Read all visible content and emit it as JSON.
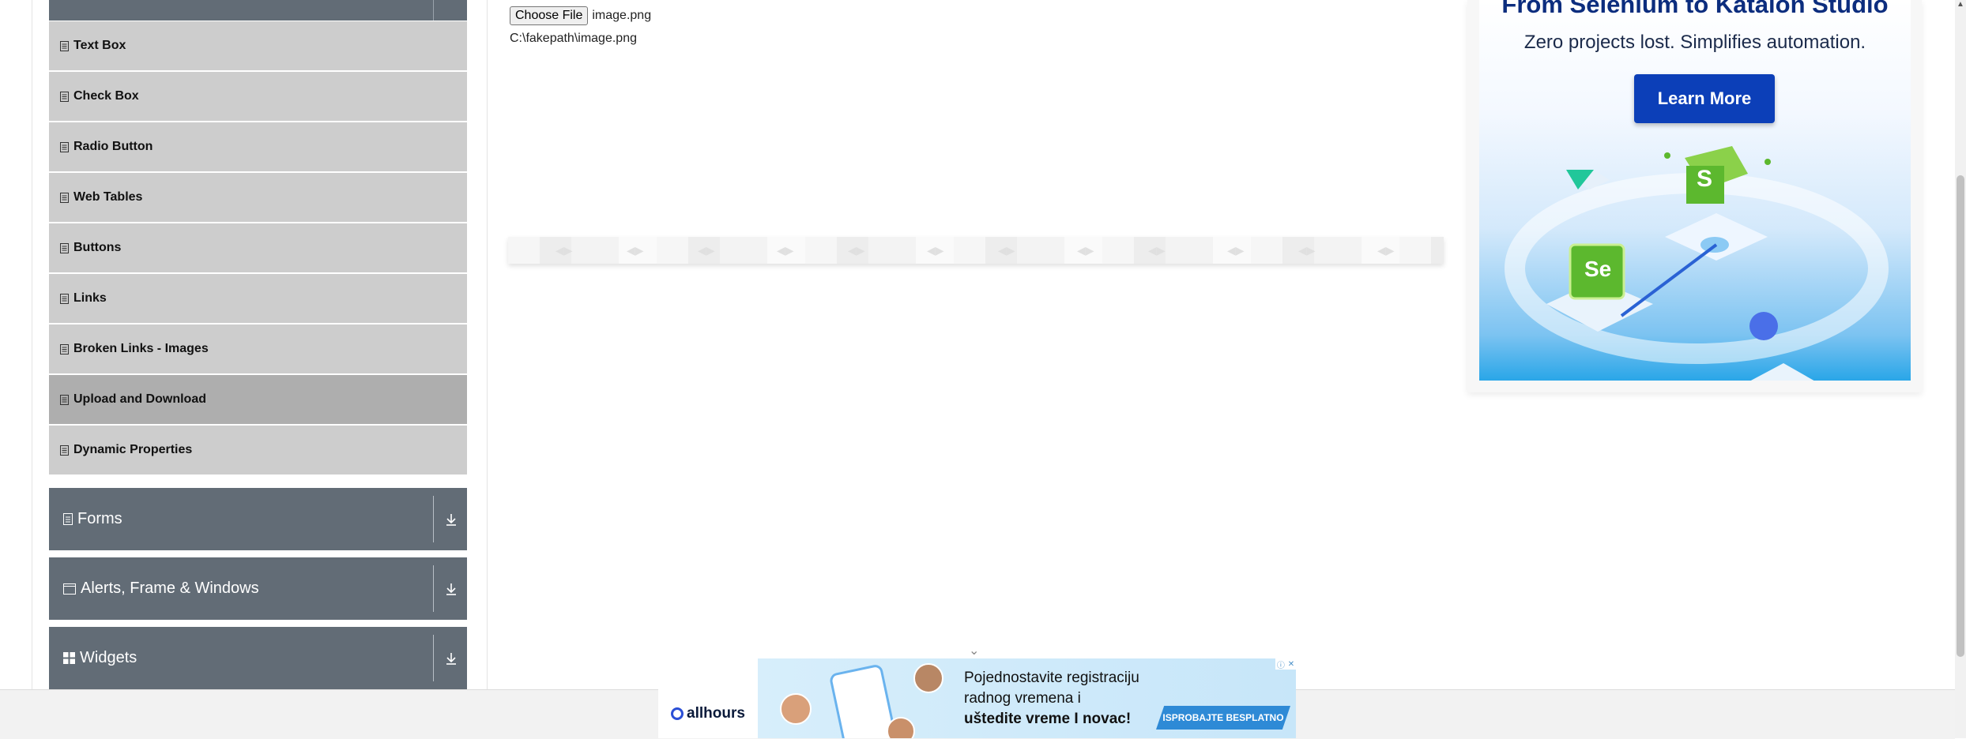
{
  "sidebar": {
    "items": [
      {
        "label": "Text Box"
      },
      {
        "label": "Check Box"
      },
      {
        "label": "Radio Button"
      },
      {
        "label": "Web Tables"
      },
      {
        "label": "Buttons"
      },
      {
        "label": "Links"
      },
      {
        "label": "Broken Links - Images"
      },
      {
        "label": "Upload and Download",
        "active": true
      },
      {
        "label": "Dynamic Properties"
      }
    ],
    "groups": [
      {
        "label": "Forms",
        "icon": "document-icon"
      },
      {
        "label": "Alerts, Frame & Windows",
        "icon": "window-icon"
      },
      {
        "label": "Widgets",
        "icon": "grid-icon"
      }
    ]
  },
  "upload": {
    "button_label": "Choose File",
    "file_name": "image.png",
    "uploaded_path": "C:\\fakepath\\image.png"
  },
  "side_ad": {
    "title": "From Selenium to Katalon Studio",
    "subtitle": "Zero projects lost. Simplifies automation.",
    "cta": "Learn More",
    "art_labels": [
      "S",
      "Se"
    ]
  },
  "bottom_ad": {
    "logo": "allhours",
    "line1": "Pojednostavite registraciju",
    "line2": "radnog vremena i",
    "line3": "uštedite vreme I novac!",
    "cta": "ISPROBAJTE BESPLATNO"
  },
  "colors": {
    "group_header": "#626c76",
    "menu_item": "#cdcdcd",
    "menu_item_active": "#aeaeae",
    "ad_title": "#0c2d7e",
    "ad_button": "#0c3fb8"
  }
}
